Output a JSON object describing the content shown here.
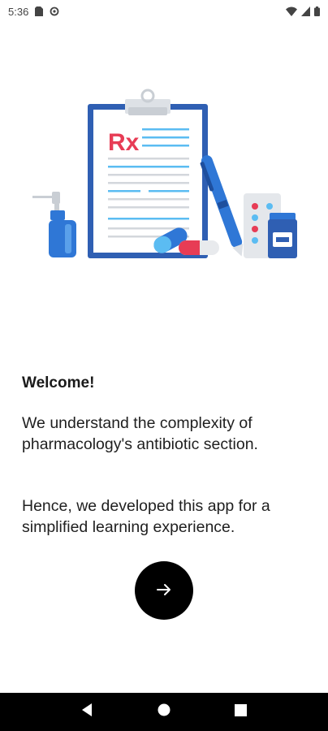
{
  "status_bar": {
    "time": "5:36",
    "icons": [
      "sim-card-icon",
      "data-saver-icon",
      "wifi-icon",
      "cellular-signal-icon",
      "battery-icon"
    ]
  },
  "illustration": {
    "rx_label": "Rx",
    "colors": {
      "clipboard": "#2f5fb3",
      "red": "#e73c55",
      "blue": "#2f77d6",
      "light_blue": "#5bbcf2",
      "gray": "#cfd3d8"
    }
  },
  "content": {
    "title": "Welcome!",
    "paragraph1": "We understand the complexity of pharmacology's antibiotic section.",
    "paragraph2": "Hence, we developed this app for a simplified learning experience."
  },
  "next_button": {
    "icon": "arrow-right-icon"
  },
  "nav_bar": {
    "icons": [
      "back-icon",
      "home-icon",
      "recents-icon"
    ]
  }
}
